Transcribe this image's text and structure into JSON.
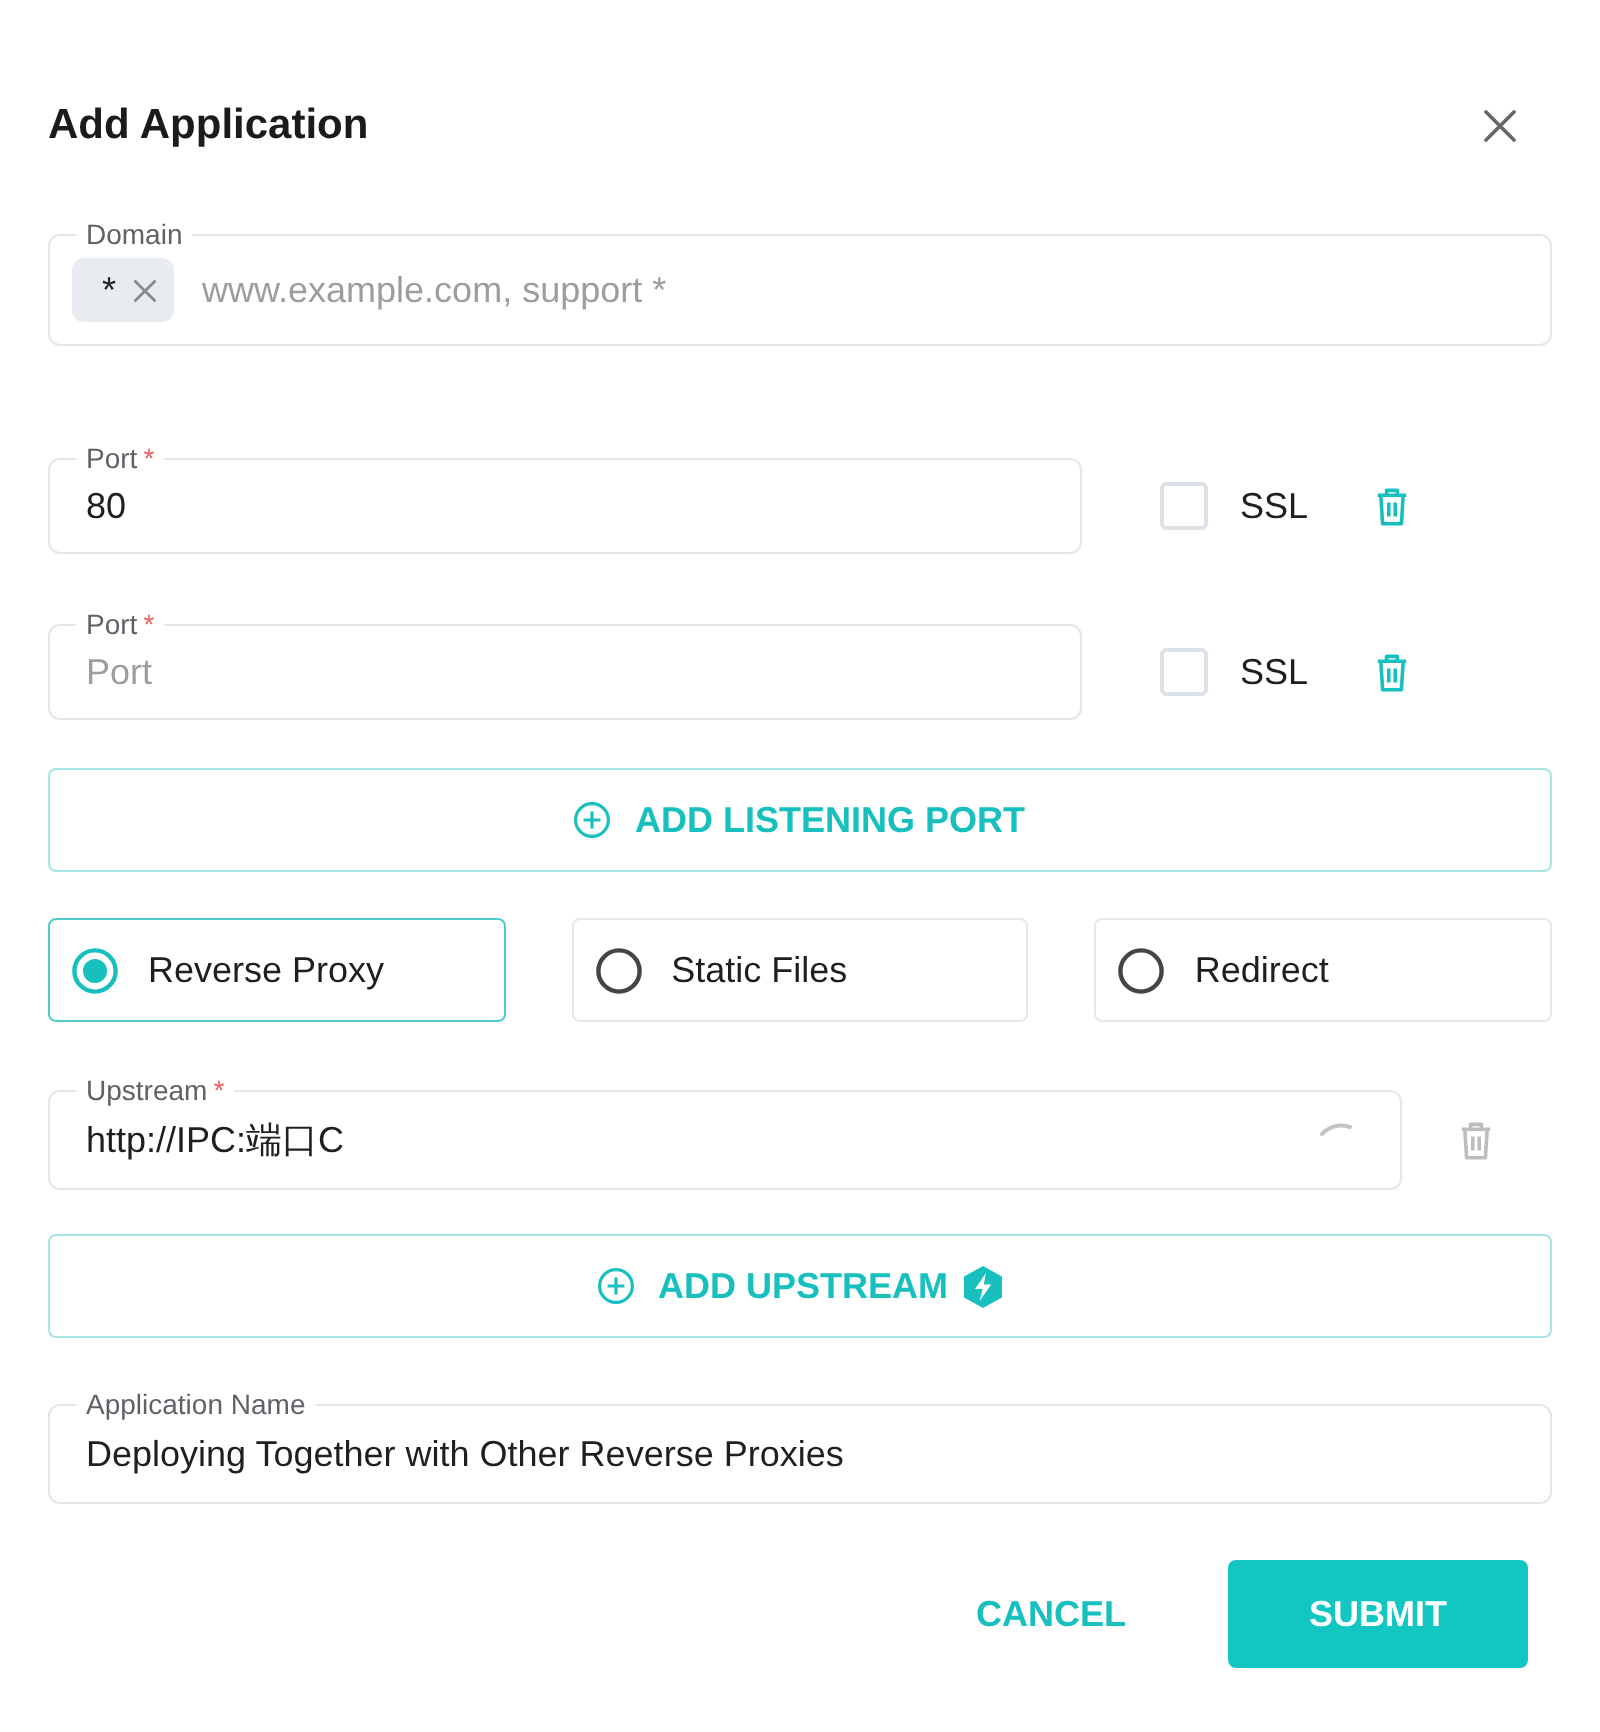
{
  "dialog": {
    "title": "Add Application"
  },
  "domain": {
    "label": "Domain",
    "tags": [
      {
        "text": "*"
      }
    ],
    "placeholder": "www.example.com, support *"
  },
  "ports": [
    {
      "label": "Port",
      "required_mark": "*",
      "value": "80",
      "ssl_label": "SSL",
      "ssl": false,
      "delete_disabled": false
    },
    {
      "label": "Port",
      "required_mark": "*",
      "placeholder": "Port",
      "ssl_label": "SSL",
      "ssl": false,
      "delete_disabled": false
    }
  ],
  "add_port_button": {
    "label": "ADD LISTENING PORT"
  },
  "modes": [
    {
      "label": "Reverse Proxy",
      "selected": true
    },
    {
      "label": "Static Files",
      "selected": false
    },
    {
      "label": "Redirect",
      "selected": false
    }
  ],
  "upstreams": [
    {
      "label": "Upstream",
      "required_mark": "*",
      "value": "http://IPC:端口C",
      "loading": true,
      "delete_disabled": true
    }
  ],
  "add_upstream_button": {
    "label": "ADD UPSTREAM"
  },
  "application_name": {
    "label": "Application Name",
    "value": "Deploying Together with Other Reverse Proxies"
  },
  "actions": [
    {
      "label": "CANCEL",
      "kind": "text"
    },
    {
      "label": "SUBMIT",
      "kind": "primary"
    }
  ]
}
